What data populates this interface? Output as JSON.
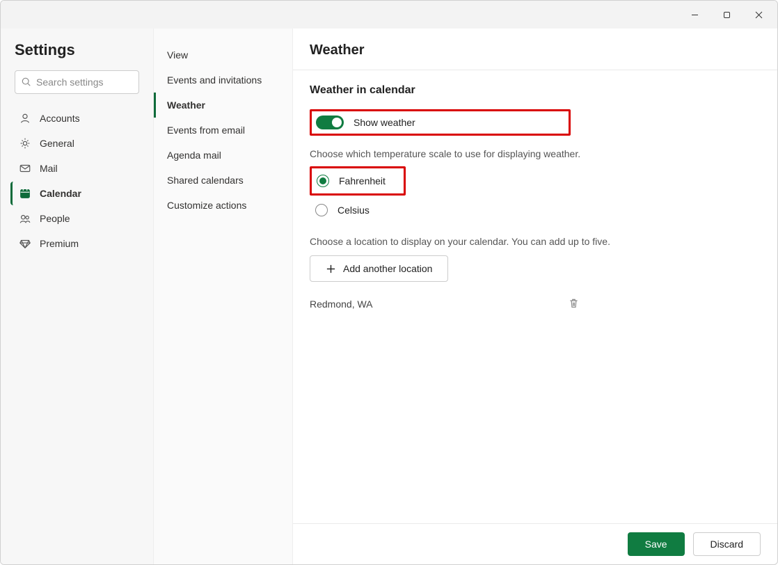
{
  "header": {
    "title": "Settings"
  },
  "search": {
    "placeholder": "Search settings"
  },
  "sidebar": {
    "items": [
      {
        "label": "Accounts"
      },
      {
        "label": "General"
      },
      {
        "label": "Mail"
      },
      {
        "label": "Calendar"
      },
      {
        "label": "People"
      },
      {
        "label": "Premium"
      }
    ]
  },
  "subnav": {
    "items": [
      {
        "label": "View"
      },
      {
        "label": "Events and invitations"
      },
      {
        "label": "Weather"
      },
      {
        "label": "Events from email"
      },
      {
        "label": "Agenda mail"
      },
      {
        "label": "Shared calendars"
      },
      {
        "label": "Customize actions"
      }
    ]
  },
  "page": {
    "title": "Weather",
    "section_title": "Weather in calendar",
    "toggle_label": "Show weather",
    "scale_desc": "Choose which temperature scale to use for displaying weather.",
    "radio_f": "Fahrenheit",
    "radio_c": "Celsius",
    "loc_desc": "Choose a location to display on your calendar. You can add up to five.",
    "add_btn": "Add another location",
    "location": "Redmond, WA"
  },
  "footer": {
    "save": "Save",
    "discard": "Discard"
  }
}
